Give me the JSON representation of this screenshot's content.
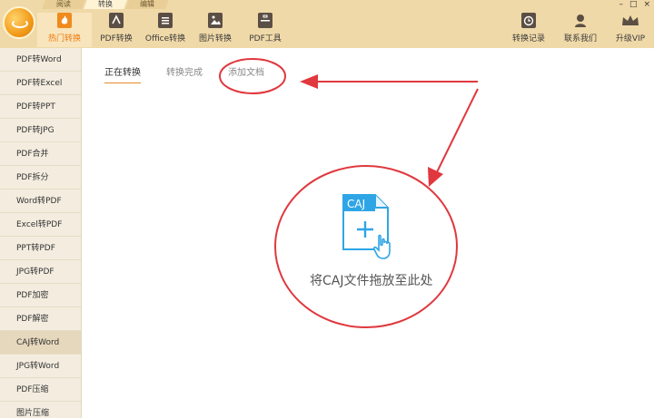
{
  "menu": {
    "tabs": [
      "阅读",
      "转换",
      "编辑"
    ],
    "active": 1
  },
  "window_controls": {
    "minimize": "–",
    "restore": "□",
    "close": "×"
  },
  "toolbar": {
    "left": [
      {
        "label": "热门转换",
        "icon": "fire-icon",
        "active": true
      },
      {
        "label": "PDF转换",
        "icon": "pdf-icon",
        "active": false
      },
      {
        "label": "Office转换",
        "icon": "office-icon",
        "active": false
      },
      {
        "label": "图片转换",
        "icon": "image-icon",
        "active": false
      },
      {
        "label": "PDF工具",
        "icon": "toolbox-icon",
        "active": false
      }
    ],
    "right": [
      {
        "label": "转换记录",
        "icon": "clock-icon"
      },
      {
        "label": "联系我们",
        "icon": "headset-icon"
      },
      {
        "label": "升级VIP",
        "icon": "crown-icon"
      }
    ]
  },
  "sidebar": {
    "items": [
      "PDF转Word",
      "PDF转Excel",
      "PDF转PPT",
      "PDF转JPG",
      "PDF合并",
      "PDF拆分",
      "Word转PDF",
      "Excel转PDF",
      "PPT转PDF",
      "JPG转PDF",
      "PDF加密",
      "PDF解密",
      "CAJ转Word",
      "JPG转Word",
      "PDF压缩",
      "图片压缩"
    ],
    "active_index": 12
  },
  "content": {
    "tabs": [
      "正在转换",
      "转换完成",
      "添加文档"
    ],
    "active_tab": 0,
    "drop_icon_label": "CAJ",
    "drop_text": "将CAJ文件拖放至此处"
  },
  "colors": {
    "accent": "#ee7a10",
    "annotation": "#e0383e",
    "topbar": "#f0d9a8",
    "icon_blue": "#2fa5e6"
  }
}
